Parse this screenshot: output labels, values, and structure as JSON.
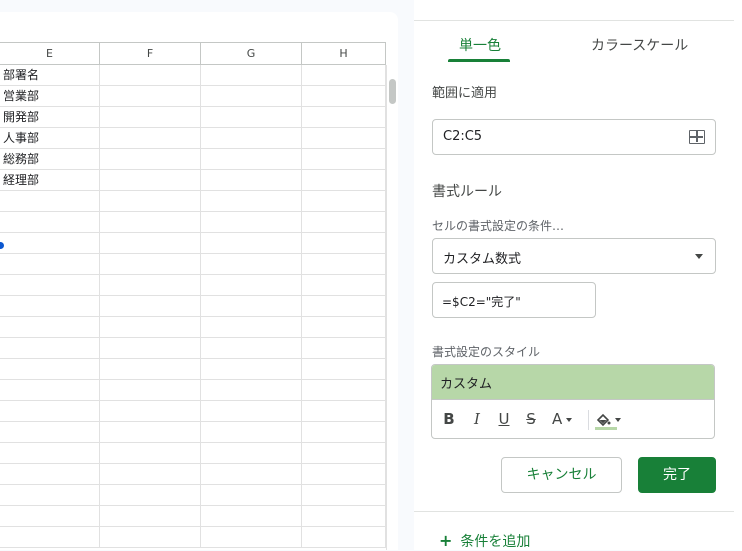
{
  "sheet": {
    "columns": [
      "E",
      "F",
      "G",
      "H"
    ],
    "column_e_values": [
      "部署名",
      "営業部",
      "開発部",
      "人事部",
      "総務部",
      "経理部"
    ],
    "row_count": 23
  },
  "panel": {
    "tabs": [
      {
        "label": "単一色",
        "active": true
      },
      {
        "label": "カラースケール",
        "active": false
      }
    ],
    "apply_to_range_label": "範囲に適用",
    "range_value": "C2:C5",
    "format_rules_label": "書式ルール",
    "condition_label": "セルの書式設定の条件…",
    "condition_value": "カスタム数式",
    "formula_value": "=$C2=\"完了\"",
    "style_label": "書式設定のスタイル",
    "style_preview_text": "カスタム",
    "style_fill_color": "#b7d7a8",
    "format_buttons": {
      "bold": "B",
      "italic": "I",
      "underline": "U",
      "strikethrough": "S",
      "text_color": "A",
      "fill_color": "paint-bucket-icon"
    },
    "cancel_label": "キャンセル",
    "done_label": "完了",
    "add_condition_label": "条件を追加",
    "accent_color": "#188038"
  }
}
